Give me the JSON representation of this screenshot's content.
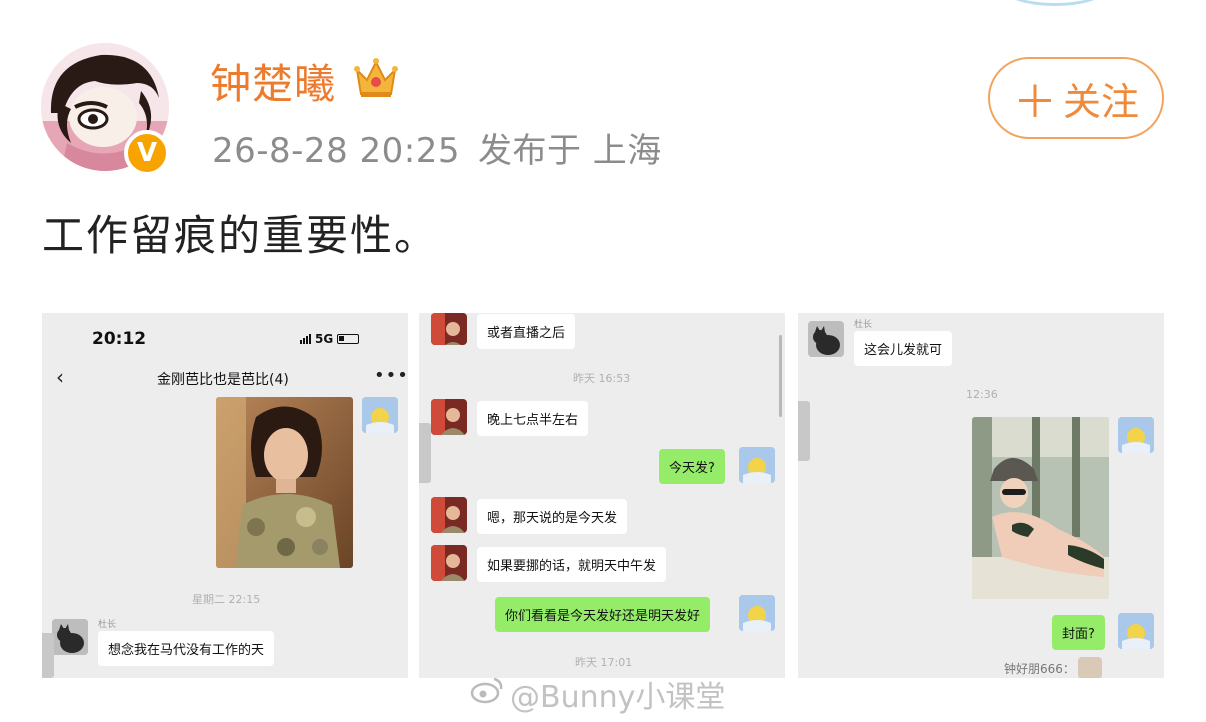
{
  "post": {
    "username": "钟楚曦",
    "verified_badge": "V",
    "timestamp": "26-8-28 20:25",
    "location": "发布于 上海",
    "follow_label": "关注",
    "follow_icon": "plus-icon",
    "text": "工作留痕的重要性。",
    "watermark": "@Bunny小课堂",
    "colors": {
      "username": "#ee7a2b",
      "follow_border": "#f2a45f",
      "bubble_me": "#95ec69",
      "panel_bg": "#ededed"
    }
  },
  "screens": [
    {
      "status_time": "20:12",
      "network": "5G",
      "chat_title": "金刚芭比也是芭比(4)",
      "more_label": "•••",
      "timestamp": "星期二 22:15",
      "sender_nick": "杜长",
      "message": "想念我在马代没有工作的天"
    },
    {
      "messages": [
        {
          "side": "left",
          "text": "或者直播之后"
        },
        {
          "side": "time",
          "text": "昨天 16:53"
        },
        {
          "side": "left",
          "text": "晚上七点半左右"
        },
        {
          "side": "right",
          "text": "今天发?"
        },
        {
          "side": "left",
          "text": "嗯，那天说的是今天发"
        },
        {
          "side": "left",
          "text": "如果要挪的话，就明天中午发"
        },
        {
          "side": "right",
          "text": "你们看看是今天发好还是明天发好"
        },
        {
          "side": "time",
          "text": "昨天 17:01"
        }
      ]
    },
    {
      "sender_nick": "杜长",
      "message": "这会儿发就可",
      "timestamp": "12:36",
      "reply": "封面?",
      "bottom_nick": "钟好朋666："
    }
  ]
}
